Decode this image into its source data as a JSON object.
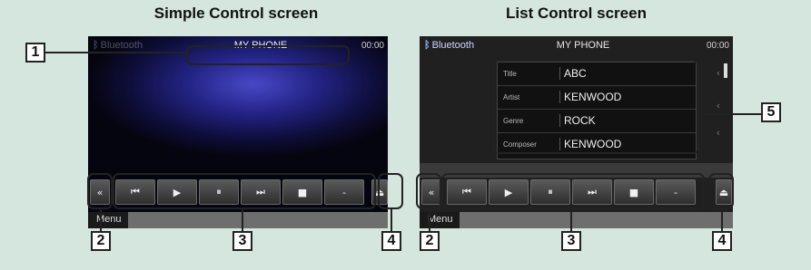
{
  "headings": {
    "simple": "Simple Control screen",
    "list": "List Control screen"
  },
  "simple_screen": {
    "source_label": "Bluetooth",
    "device_name": "MY PHONE",
    "time": "00:00",
    "menu_label": "Menu"
  },
  "list_screen": {
    "source_label": "Bluetooth",
    "device_name": "MY PHONE",
    "time": "00:00",
    "menu_label": "Menu",
    "info_rows": [
      {
        "label": "Title",
        "value": "ABC"
      },
      {
        "label": "Artist",
        "value": "KENWOOD"
      },
      {
        "label": "Genre",
        "value": "ROCK"
      },
      {
        "label": "Composer",
        "value": "KENWOOD"
      }
    ]
  },
  "controls": {
    "toggle_icon": "double-chevron-left-icon",
    "toggle_glyph": "«",
    "prev_glyph": "⏮",
    "play_glyph": "▶",
    "pause_glyph": "⏸",
    "next_glyph": "⏭",
    "stop_glyph": "■",
    "minus_glyph": "-",
    "eject_glyph": "⏏"
  },
  "callouts": {
    "c1": "1",
    "c2": "2",
    "c3": "3",
    "c4": "4",
    "c5": "5"
  },
  "colors": {
    "background": "#d5e6de",
    "callout_border": "#222222"
  }
}
